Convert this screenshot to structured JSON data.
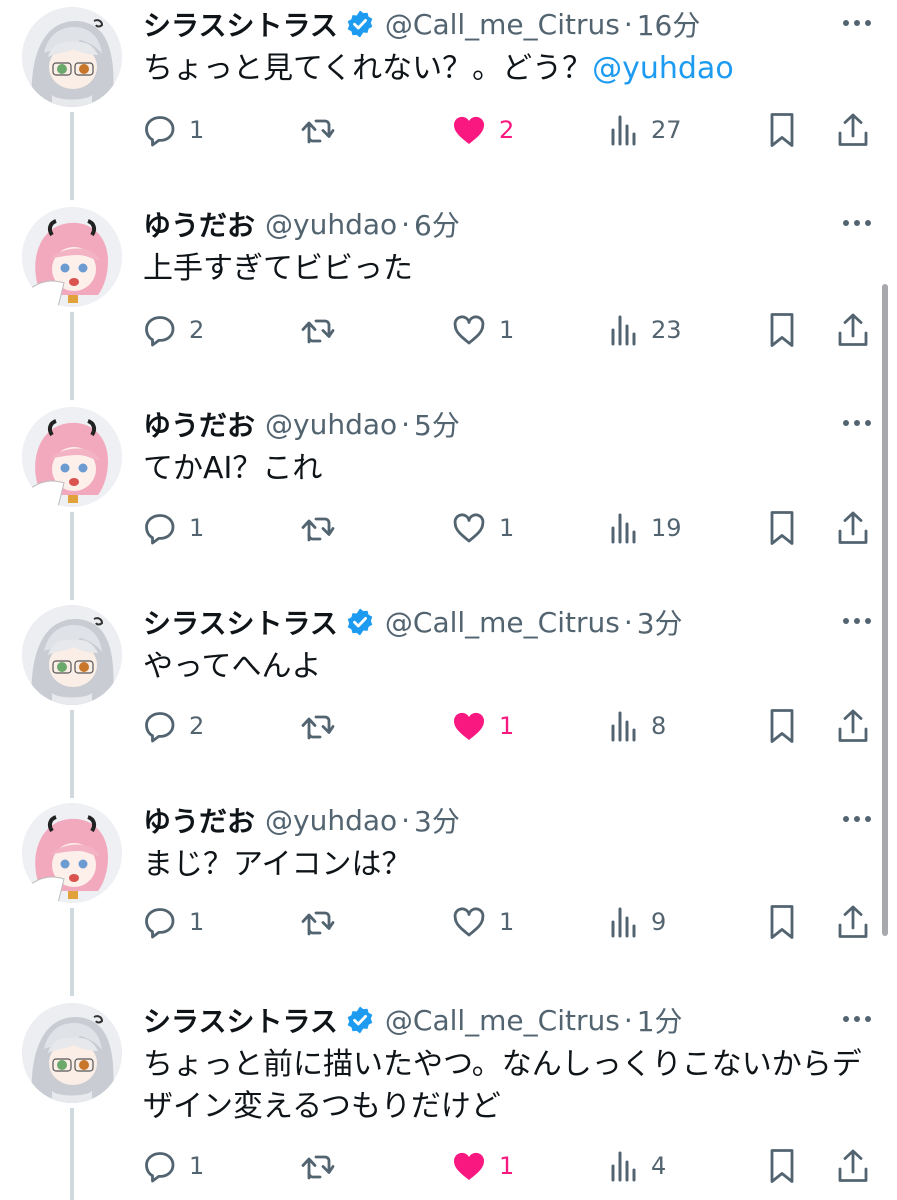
{
  "colors": {
    "accent": "#1d9bf0",
    "like": "#f91880",
    "muted": "#536471",
    "text": "#0f1419",
    "thread_line": "#cfd9de"
  },
  "icons": {
    "reply": "reply-icon",
    "retweet": "retweet-icon",
    "like": "heart-icon",
    "views": "views-icon",
    "bookmark": "bookmark-icon",
    "share": "share-icon",
    "verified": "verified-badge-icon",
    "more": "more-icon"
  },
  "sep": "·",
  "tweets": [
    {
      "author": "シラスシトラス",
      "verified": true,
      "avatar": "silver-hair-avatar",
      "handle": "@Call_me_Citrus",
      "time": "16分",
      "text": "ちょっと見てくれない？。どう？",
      "mention": "@yuhdao",
      "replies": "1",
      "retweets": "",
      "likes": "2",
      "liked": true,
      "views": "27"
    },
    {
      "author": "ゆうだお",
      "verified": false,
      "avatar": "pink-hair-avatar",
      "handle": "@yuhdao",
      "time": "6分",
      "text": "上手すぎてビビった",
      "replies": "2",
      "retweets": "",
      "likes": "1",
      "liked": false,
      "views": "23"
    },
    {
      "author": "ゆうだお",
      "verified": false,
      "avatar": "pink-hair-avatar",
      "handle": "@yuhdao",
      "time": "5分",
      "text": "てかAI？これ",
      "replies": "1",
      "retweets": "",
      "likes": "1",
      "liked": false,
      "views": "19"
    },
    {
      "author": "シラスシトラス",
      "verified": true,
      "avatar": "silver-hair-avatar",
      "handle": "@Call_me_Citrus",
      "time": "3分",
      "text": "やってへんよ",
      "replies": "2",
      "retweets": "",
      "likes": "1",
      "liked": true,
      "views": "8"
    },
    {
      "author": "ゆうだお",
      "verified": false,
      "avatar": "pink-hair-avatar",
      "handle": "@yuhdao",
      "time": "3分",
      "text": "まじ？アイコンは？",
      "replies": "1",
      "retweets": "",
      "likes": "1",
      "liked": false,
      "views": "9"
    },
    {
      "author": "シラスシトラス",
      "verified": true,
      "avatar": "silver-hair-avatar",
      "handle": "@Call_me_Citrus",
      "time": "1分",
      "text": "ちょっと前に描いたやつ。なんしっくりこないからデザイン変えるつもりだけど",
      "replies": "1",
      "retweets": "",
      "likes": "1",
      "liked": true,
      "views": "4"
    }
  ]
}
